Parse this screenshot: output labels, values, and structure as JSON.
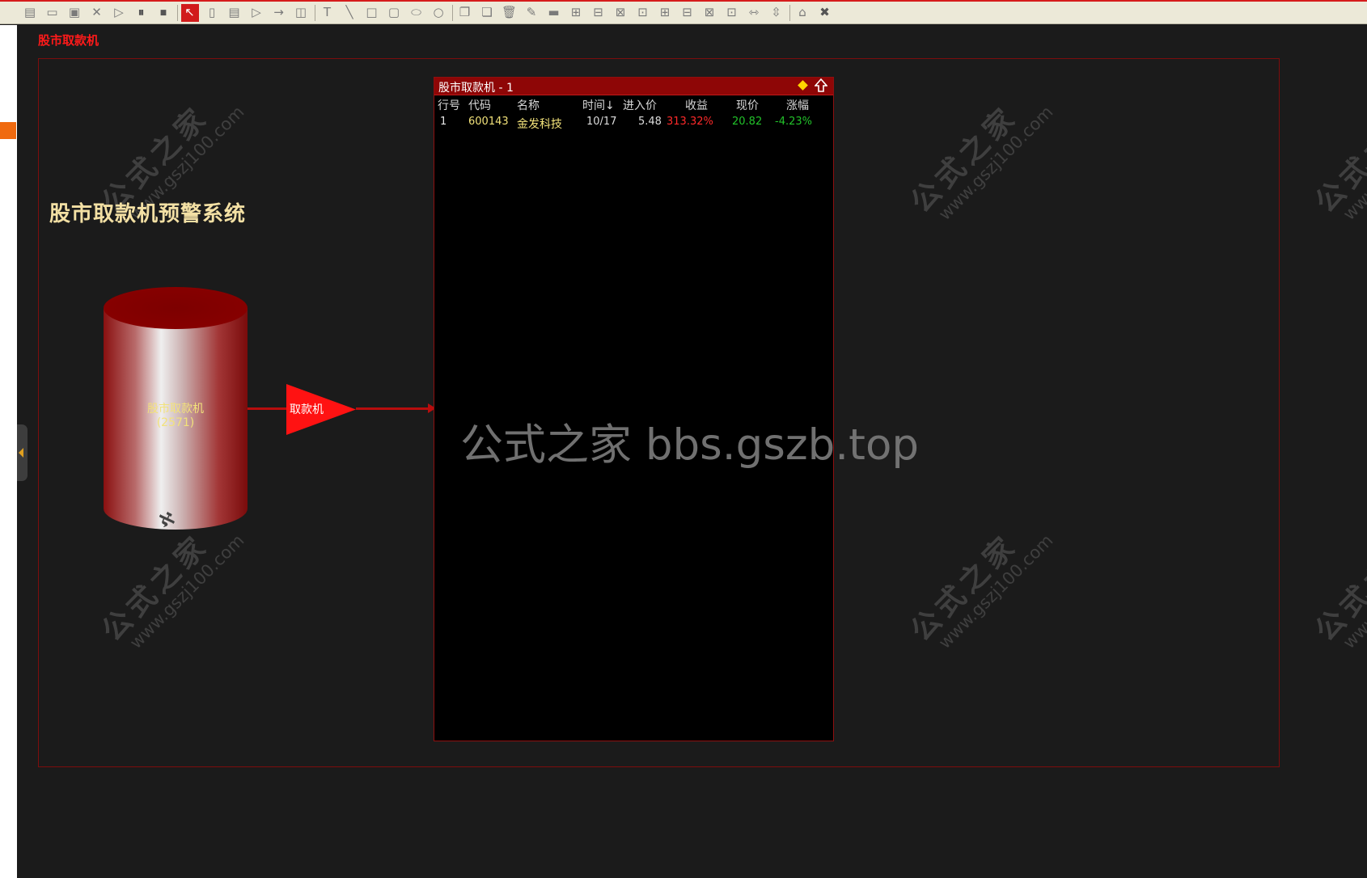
{
  "window": {
    "title": "股市取款机"
  },
  "toolbar": {
    "buttons": [
      {
        "name": "new-doc-icon",
        "glyph": "▤"
      },
      {
        "name": "open-folder-icon",
        "glyph": "▭"
      },
      {
        "name": "save-icon",
        "glyph": "▣"
      },
      {
        "name": "delete-x-icon",
        "glyph": "✕"
      },
      {
        "name": "play-icon",
        "glyph": "▷"
      },
      {
        "name": "pause-icon",
        "glyph": "⏸"
      },
      {
        "name": "stop-icon",
        "glyph": "⏹"
      },
      {
        "name": "select-pointer-icon",
        "glyph": "↖"
      },
      {
        "name": "rounded-rect-icon",
        "glyph": "▯"
      },
      {
        "name": "list-box-icon",
        "glyph": "▤"
      },
      {
        "name": "triangle-icon",
        "glyph": "▷"
      },
      {
        "name": "arrow-right-icon",
        "glyph": "→"
      },
      {
        "name": "grouped-rect-icon",
        "glyph": "◫"
      },
      {
        "name": "text-icon",
        "glyph": "T"
      },
      {
        "name": "line-icon",
        "glyph": "╲"
      },
      {
        "name": "rectangle-icon",
        "glyph": "□"
      },
      {
        "name": "round-rect-icon",
        "glyph": "▢"
      },
      {
        "name": "ellipse-icon",
        "glyph": "⬭"
      },
      {
        "name": "circle-icon",
        "glyph": "○"
      },
      {
        "name": "copy-icon",
        "glyph": "❐"
      },
      {
        "name": "paste-icon",
        "glyph": "❏"
      },
      {
        "name": "trash-icon",
        "glyph": "🗑"
      },
      {
        "name": "brush-icon",
        "glyph": "✎"
      },
      {
        "name": "bar-icon",
        "glyph": "▬"
      },
      {
        "name": "align-left-icon",
        "glyph": "⊞"
      },
      {
        "name": "align-center-icon",
        "glyph": "⊟"
      },
      {
        "name": "align-right-icon",
        "glyph": "⊠"
      },
      {
        "name": "align-top-icon",
        "glyph": "⊡"
      },
      {
        "name": "align-middle-icon",
        "glyph": "⊞"
      },
      {
        "name": "align-bottom-icon",
        "glyph": "⊟"
      },
      {
        "name": "distribute-h-icon",
        "glyph": "⊠"
      },
      {
        "name": "distribute-v-icon",
        "glyph": "⊡"
      },
      {
        "name": "same-width-icon",
        "glyph": "⇿"
      },
      {
        "name": "same-height-icon",
        "glyph": "⇳"
      },
      {
        "name": "chart-icon",
        "glyph": "⌂"
      },
      {
        "name": "close-icon",
        "glyph": "✖"
      }
    ]
  },
  "canvas": {
    "title": "股市取款机预警系统",
    "watermark": {
      "cn": "公式之家",
      "url": "www.gszj100.com"
    },
    "center_watermark": "公式之家 bbs.gszb.top",
    "cylinder": {
      "label": "股市取款机",
      "count": "(2571)"
    },
    "trigger": {
      "label": "取款机"
    },
    "colors": {
      "accent": "#d61b1b",
      "header": "#8e0606",
      "label": "#f2e27a"
    }
  },
  "panel": {
    "title": "股市取款机 - 1",
    "columns": [
      "行号",
      "代码",
      "名称",
      "时间↓",
      "进入价",
      "收益",
      "现价",
      "涨幅"
    ],
    "rows": [
      {
        "row_no": "1",
        "code": "600143",
        "name": "金发科技",
        "time": "10/17",
        "entry_price": "5.48",
        "gain": "313.32%",
        "price": "20.82",
        "change": "-4.23%"
      }
    ]
  }
}
